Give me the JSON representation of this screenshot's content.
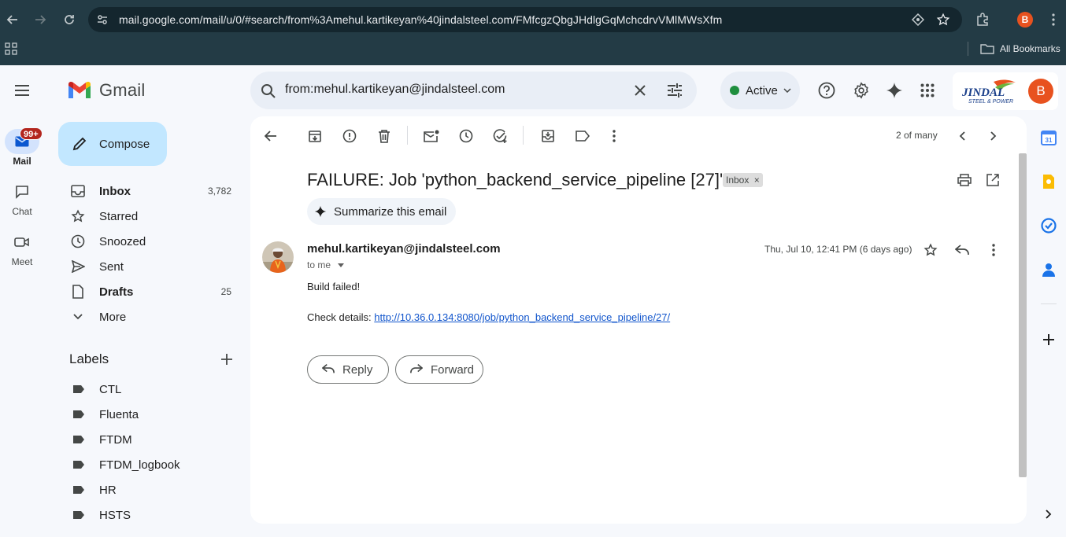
{
  "browser": {
    "url": "mail.google.com/mail/u/0/#search/from%3Amehul.kartikeyan%40jindalsteel.com/FMfcgzQbgJHdlgGqMchcdrvVMlMWsXfm",
    "profile_initial": "B",
    "bookmarks_label": "All Bookmarks"
  },
  "header": {
    "app_name": "Gmail",
    "search_value": "from:mehul.kartikeyan@jindalsteel.com",
    "status": "Active",
    "status_color": "#1e8e3e",
    "brand_logo_text": "JINDAL",
    "brand_logo_sub": "STEEL & POWER",
    "account_initial": "B"
  },
  "rail": {
    "items": [
      {
        "label": "Mail",
        "icon": "mail-icon",
        "badge": "99+",
        "active": true
      },
      {
        "label": "Chat",
        "icon": "chat-icon"
      },
      {
        "label": "Meet",
        "icon": "video-icon"
      }
    ]
  },
  "sidebar": {
    "compose_label": "Compose",
    "items": [
      {
        "label": "Inbox",
        "count": "3,782",
        "bold": true,
        "icon": "inbox-icon"
      },
      {
        "label": "Starred",
        "count": "",
        "icon": "star-icon"
      },
      {
        "label": "Snoozed",
        "count": "",
        "icon": "clock-icon"
      },
      {
        "label": "Sent",
        "count": "",
        "icon": "send-icon"
      },
      {
        "label": "Drafts",
        "count": "25",
        "bold": true,
        "icon": "draft-icon"
      },
      {
        "label": "More",
        "count": "",
        "icon": "chevron-down-icon"
      }
    ],
    "labels_title": "Labels",
    "labels": [
      "CTL",
      "Fluenta",
      "FTDM",
      "FTDM_logbook",
      "HR",
      "HSTS"
    ]
  },
  "toolbar": {
    "page_count": "2 of many"
  },
  "message": {
    "subject": "FAILURE: Job 'python_backend_service_pipeline [27]'",
    "inbox_chip": "Inbox",
    "summarize_label": "Summarize this email",
    "sender": "mehul.kartikeyan@jindalsteel.com",
    "to_line": "to me",
    "date": "Thu, Jul 10, 12:41 PM (6 days ago)",
    "body_line1": "Build failed!",
    "body_prefix": "Check details:",
    "body_link": "http://10.36.0.134:8080/job/python_backend_service_pipeline/27/",
    "reply_label": "Reply",
    "forward_label": "Forward"
  },
  "right_rail": {
    "icons": [
      "calendar-icon",
      "keep-icon",
      "tasks-icon",
      "contacts-icon",
      "add-icon"
    ],
    "calendar_day": "31"
  }
}
